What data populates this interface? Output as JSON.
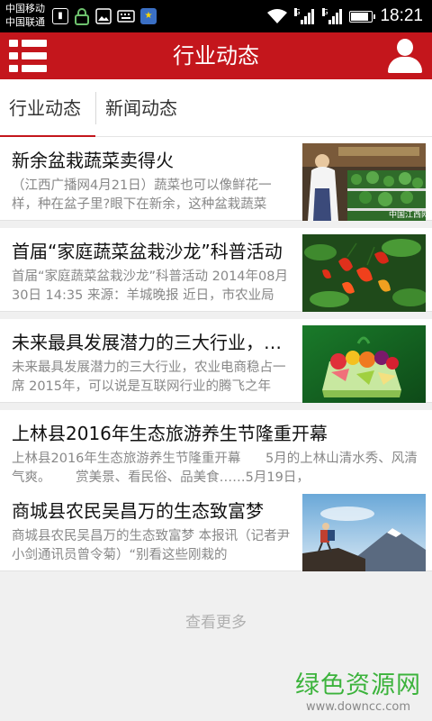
{
  "status_bar": {
    "carrier_1": "中国移动",
    "carrier_2": "中国联通",
    "time": "18:21",
    "network_1": "G",
    "network_2": "G",
    "icons": [
      "sim-icon",
      "lock-icon",
      "image-icon",
      "keyboard-icon",
      "star-app-icon",
      "wifi-icon",
      "signal-icon",
      "battery-icon"
    ],
    "battery_level": 0.85
  },
  "app_bar": {
    "title": "行业动态",
    "menu_icon": "menu-list-icon",
    "user_icon": "user-icon",
    "color": "#c4161c"
  },
  "tabs": [
    {
      "label": "行业动态",
      "active": true
    },
    {
      "label": "新闻动态",
      "active": false
    }
  ],
  "articles": [
    {
      "title": "新余盆栽蔬菜卖得火",
      "summary": "（江西广播网4月21日）蔬菜也可以像鲜花一样，种在盆子里?眼下在新余，这种盆栽蔬菜",
      "thumbnail": "greenhouse-worker-photo",
      "watermark": "中国江西网"
    },
    {
      "title": "首届“家庭蔬菜盆栽沙龙”科普活动",
      "summary": "首届“家庭蔬菜盆栽沙龙”科普活动 2014年08月30日 14:35 来源：羊城晚报 近日，市农业局",
      "thumbnail": "red-peppers-photo"
    },
    {
      "title": "未来最具发展潜力的三大行业，…",
      "summary": "未来最具发展潜力的三大行业，农业电商稳占一席 2015年，可以说是互联网行业的腾飞之年",
      "thumbnail": "fruit-gift-box-photo"
    },
    {
      "title": "上林县2016年生态旅游养生节隆重开幕",
      "summary": "上林县2016年生态旅游养生节隆重开幕      5月的上林山清水秀、风清气爽。      赏美景、看民俗、品美食……5月19日，",
      "thumbnail": null
    },
    {
      "title": "商城县农民吴昌万的生态致富梦",
      "summary": "商城县农民吴昌万的生态致富梦 本报讯（记者尹小剑通讯员曾令菊）“别看这些刚栽的",
      "thumbnail": "mountain-hiker-photo"
    }
  ],
  "load_more": "查看更多",
  "watermark": {
    "name": "绿色资源网",
    "url": "www.downcc.com"
  }
}
